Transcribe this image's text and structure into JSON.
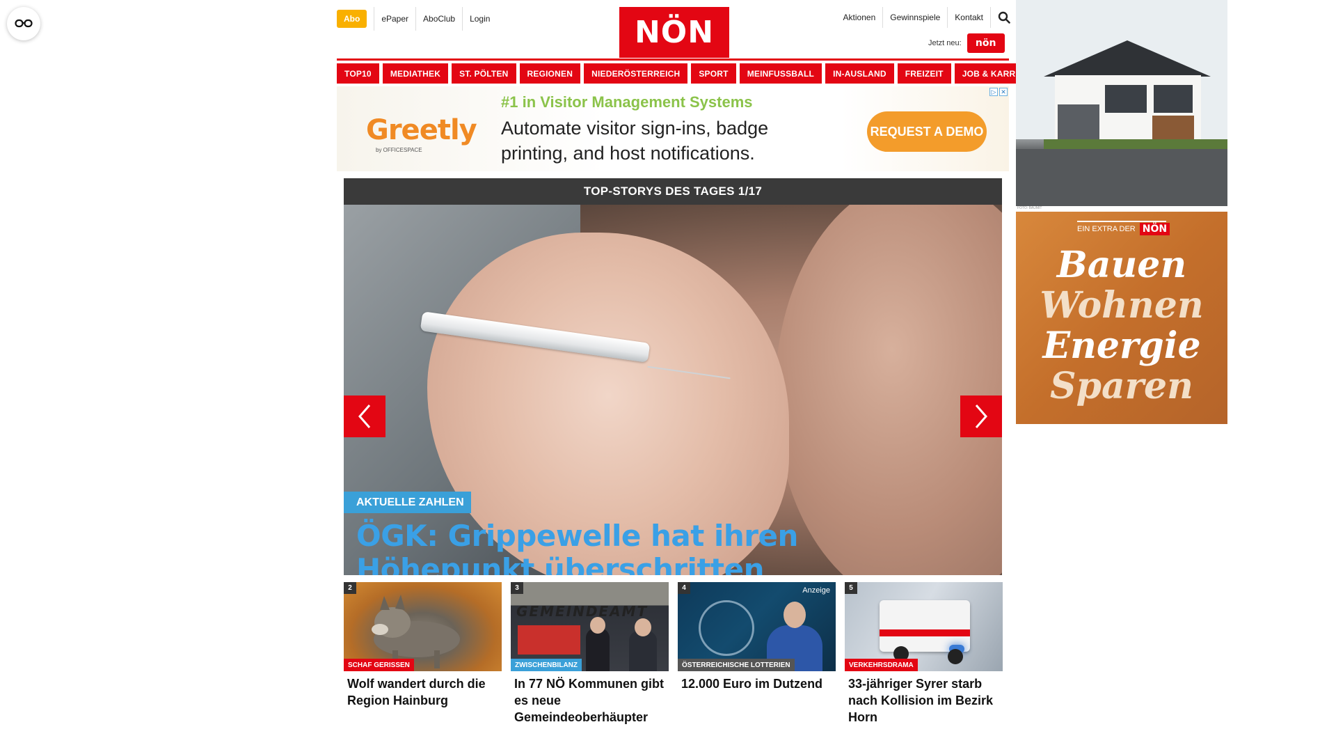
{
  "header": {
    "abo_label": "Abo",
    "left_links": [
      "ePaper",
      "AboClub",
      "Login"
    ],
    "logo_text": "NÖN",
    "right_links": [
      "Aktionen",
      "Gewinnspiele",
      "Kontakt"
    ],
    "jetzt_label": "Jetzt neu:",
    "jetzt_badge": "nön"
  },
  "nav": [
    "TOP10",
    "MEDIATHEK",
    "ST. PÖLTEN",
    "REGIONEN",
    "NIEDERÖSTERREICH",
    "SPORT",
    "MEINFUSSBALL",
    "IN-AUSLAND",
    "FREIZEIT",
    "JOB & KARRIERE"
  ],
  "ad_banner": {
    "brand": "Greetly",
    "brand_sub": "by OFFICESPACE",
    "headline": "#1 in Visitor Management Systems",
    "text_line1": "Automate visitor sign-ins, badge",
    "text_line2": "printing, and host notifications.",
    "cta": "REQUEST A DEMO"
  },
  "hero": {
    "header": "TOP-STORYS DES TAGES 1/17",
    "tag": "AKTUELLE ZAHLEN",
    "title": "ÖGK: Grippewelle hat ihren Höhepunkt überschritten"
  },
  "cards": [
    {
      "num": "2",
      "tag": "SCHAF GERISSEN",
      "tag_color": "#e30613",
      "title": "Wolf wandert durch die Region Hainburg"
    },
    {
      "num": "3",
      "tag": "ZWISCHENBILANZ",
      "tag_color": "#3aa0d8",
      "title": "In 77 NÖ Kommunen gibt es neue Gemeindeoberhäupter",
      "image_text": "GEMEINDEAMT"
    },
    {
      "num": "4",
      "tag": "ÖSTERREICHISCHE LOTTERIEN",
      "tag_color": "#555555",
      "title": "12.000 Euro im Dutzend",
      "anzeige": "Anzeige"
    },
    {
      "num": "5",
      "tag": "VERKEHRSDRAMA",
      "tag_color": "#e30613",
      "title": "33-jähriger Syrer starb nach Kollision im Bezirk Horn"
    }
  ],
  "right_ads": {
    "house_caption": "FOTO: BAUMIT",
    "bauen_extra": "EIN EXTRA DER",
    "bauen_logo": "NÖN",
    "words": [
      "Bauen",
      "Wohnen",
      "Energie",
      "Sparen"
    ]
  },
  "colors": {
    "brand_red": "#e30613",
    "abo_yellow": "#f9b000",
    "hero_blue": "#3aa0e6"
  }
}
